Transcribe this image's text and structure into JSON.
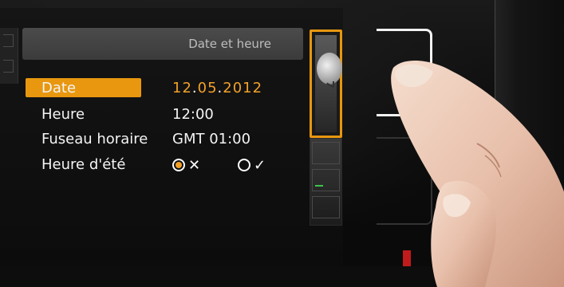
{
  "header": {
    "title": "Date et heure"
  },
  "rows": [
    {
      "label": "Date",
      "value": "12.05.2012",
      "value_parts": [
        "12",
        ".",
        "05",
        ".",
        "2012"
      ],
      "selected": true
    },
    {
      "label": "Heure",
      "value": "12:00"
    },
    {
      "label": "Fuseau horaire",
      "value": "GMT 01:00"
    },
    {
      "label": "Heure d'été",
      "options": [
        {
          "glyph": "✕",
          "selected": true
        },
        {
          "glyph": "✓",
          "selected": false
        }
      ]
    }
  ],
  "side_buttons": {
    "clock": {
      "icon": "clock-icon",
      "active": true
    },
    "nav": {
      "icon": "arrow-icon",
      "color": "#3cc64a"
    }
  },
  "colors": {
    "accent": "#e8970f",
    "date_value": "#f3a12a",
    "text": "#f4f4f4",
    "header_bg": "#444444"
  }
}
